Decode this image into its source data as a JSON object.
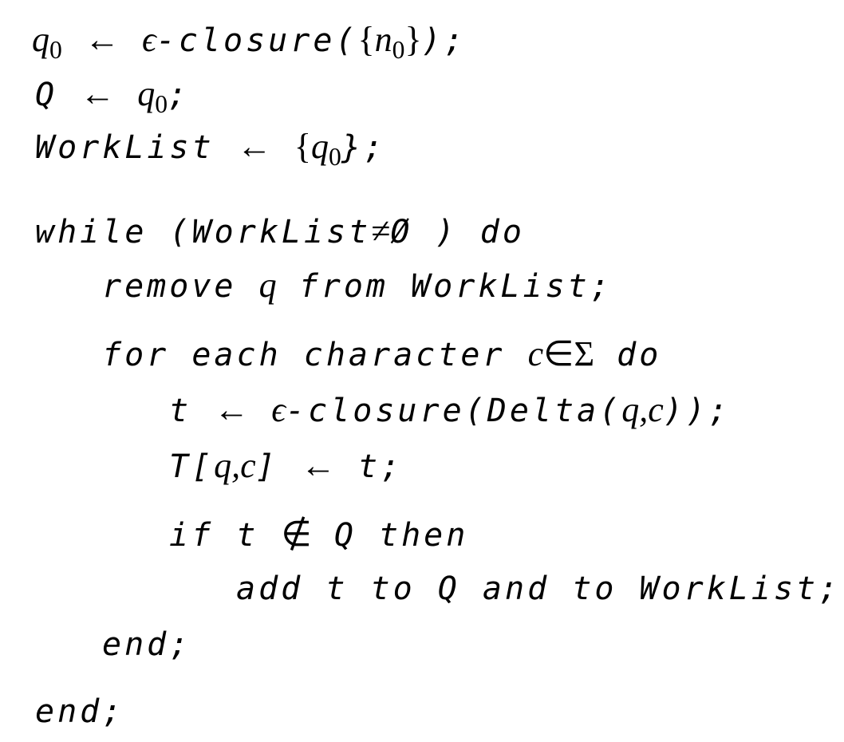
{
  "algorithm": {
    "l1": {
      "a": "q",
      "a_sub": "0",
      "b": "←",
      "c": "ϵ",
      "d": "-closure(",
      "e": "{",
      "f": "n",
      "f_sub": "0",
      "g": "}",
      "h": ");"
    },
    "l2": {
      "a": "Q",
      "b": "←",
      "c": "q",
      "c_sub": "0",
      "d": ";"
    },
    "l3": {
      "a": "WorkList",
      "b": "←",
      "c": "{",
      "d": "q",
      "d_sub": "0",
      "e": "};"
    },
    "l4": {
      "a": "while (WorkList",
      "b": "≠",
      "c": "Ø",
      "d": ") do"
    },
    "l5": {
      "a": "remove",
      "b": "q",
      "c": "from WorkList;"
    },
    "l6": {
      "a": "for each character",
      "b": "c",
      "c": "∈",
      "d": "Σ",
      "e": "do"
    },
    "l7": {
      "a": "t",
      "b": "←",
      "c": "ϵ",
      "d": "-closure(Delta(",
      "e": "q,",
      "f": "c",
      "g": "));"
    },
    "l8": {
      "a": "T[",
      "b": "q,",
      "c": "c",
      "d": "]",
      "e": "←",
      "f": "t;"
    },
    "l9": {
      "a": "if t",
      "b": "∉",
      "c": "Q then"
    },
    "l10": {
      "a": "add t to Q and to WorkList;"
    },
    "l11": {
      "a": "end;"
    },
    "l12": {
      "a": "end;"
    }
  }
}
